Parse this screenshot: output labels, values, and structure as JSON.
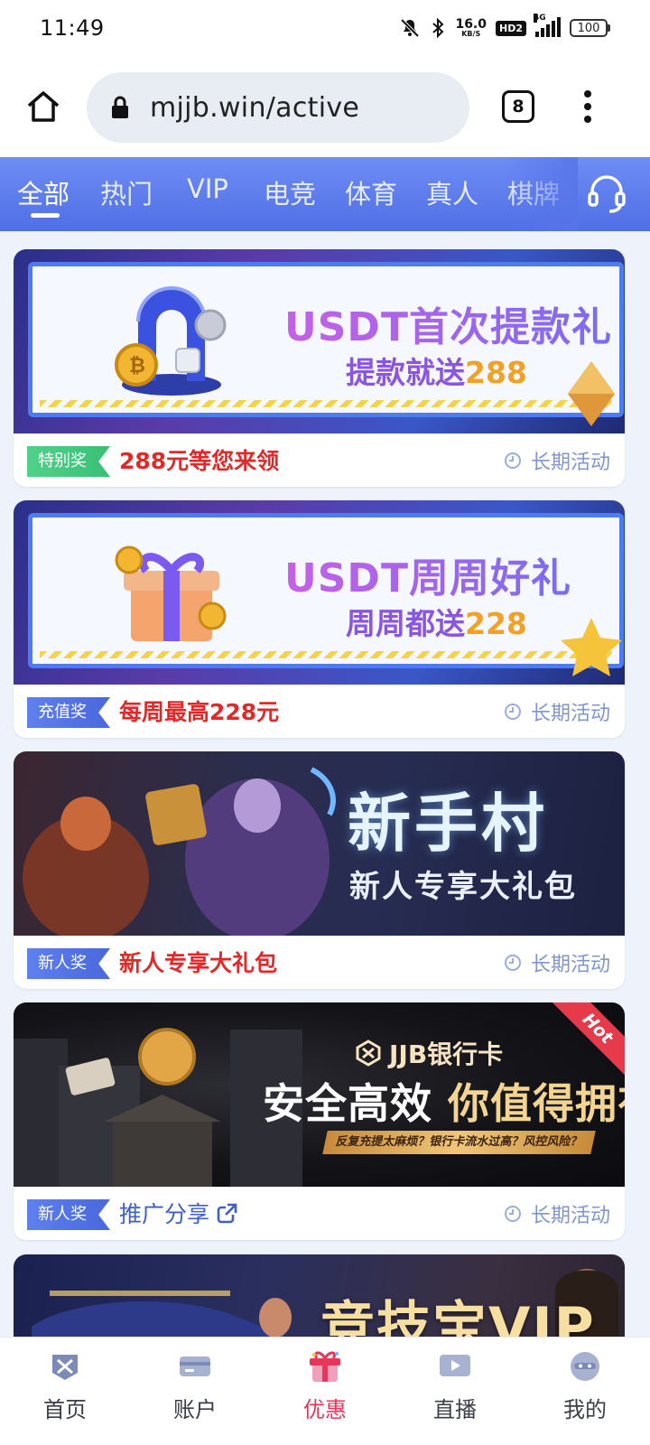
{
  "status_bar": {
    "time": "11:49",
    "net_speed_value": "16.0",
    "net_speed_unit": "KB/S",
    "hd_label": "HD2",
    "network_label": "4G",
    "battery": "100"
  },
  "browser": {
    "url": "mjjb.win/active",
    "tab_count": "8"
  },
  "category_nav": {
    "items": [
      "全部",
      "热门",
      "VIP",
      "电竞",
      "体育",
      "真人",
      "棋牌"
    ],
    "active_index": 0
  },
  "promotions": [
    {
      "banner_title": "USDT首次提款礼",
      "banner_subtitle_text": "提款就送",
      "banner_subtitle_number": "288",
      "badge": "特别奖",
      "badge_color": "#3bbf75",
      "title": "288元等您来领",
      "duration": "长期活动"
    },
    {
      "banner_title": "USDT周周好礼",
      "banner_subtitle_text": "周周都送",
      "banner_subtitle_number": "228",
      "badge": "充值奖",
      "badge_color": "#4868dd",
      "title": "每周最高228元",
      "duration": "长期活动"
    },
    {
      "banner_title": "新手村",
      "banner_subtitle": "新人专享大礼包",
      "badge": "新人奖",
      "badge_color": "#4868dd",
      "title": "新人专享大礼包",
      "duration": "长期活动"
    },
    {
      "banner_brand": "JJB银行卡",
      "banner_title_white": "安全高效",
      "banner_title_gold": "你值得拥有",
      "banner_note": "反复充提太麻烦？银行卡流水过高？风控风险？",
      "banner_ribbon": "Hot",
      "badge": "新人奖",
      "badge_color": "#4868dd",
      "title": "推广分享",
      "duration": "长期活动"
    },
    {
      "banner_title": "竞技宝VIP"
    }
  ],
  "tab_bar": {
    "items": [
      {
        "label": "首页",
        "icon": "home-icon"
      },
      {
        "label": "账户",
        "icon": "wallet-card-icon"
      },
      {
        "label": "优惠",
        "icon": "gift-icon"
      },
      {
        "label": "直播",
        "icon": "live-video-icon"
      },
      {
        "label": "我的",
        "icon": "profile-icon"
      }
    ],
    "active_index": 2,
    "active_color": "#e8355a"
  },
  "colors": {
    "nav_gradient_start": "#6f8df4",
    "nav_gradient_end": "#4f6fe6",
    "promo_title_red": "#e02a2a",
    "duration_text": "#7f96cf"
  }
}
